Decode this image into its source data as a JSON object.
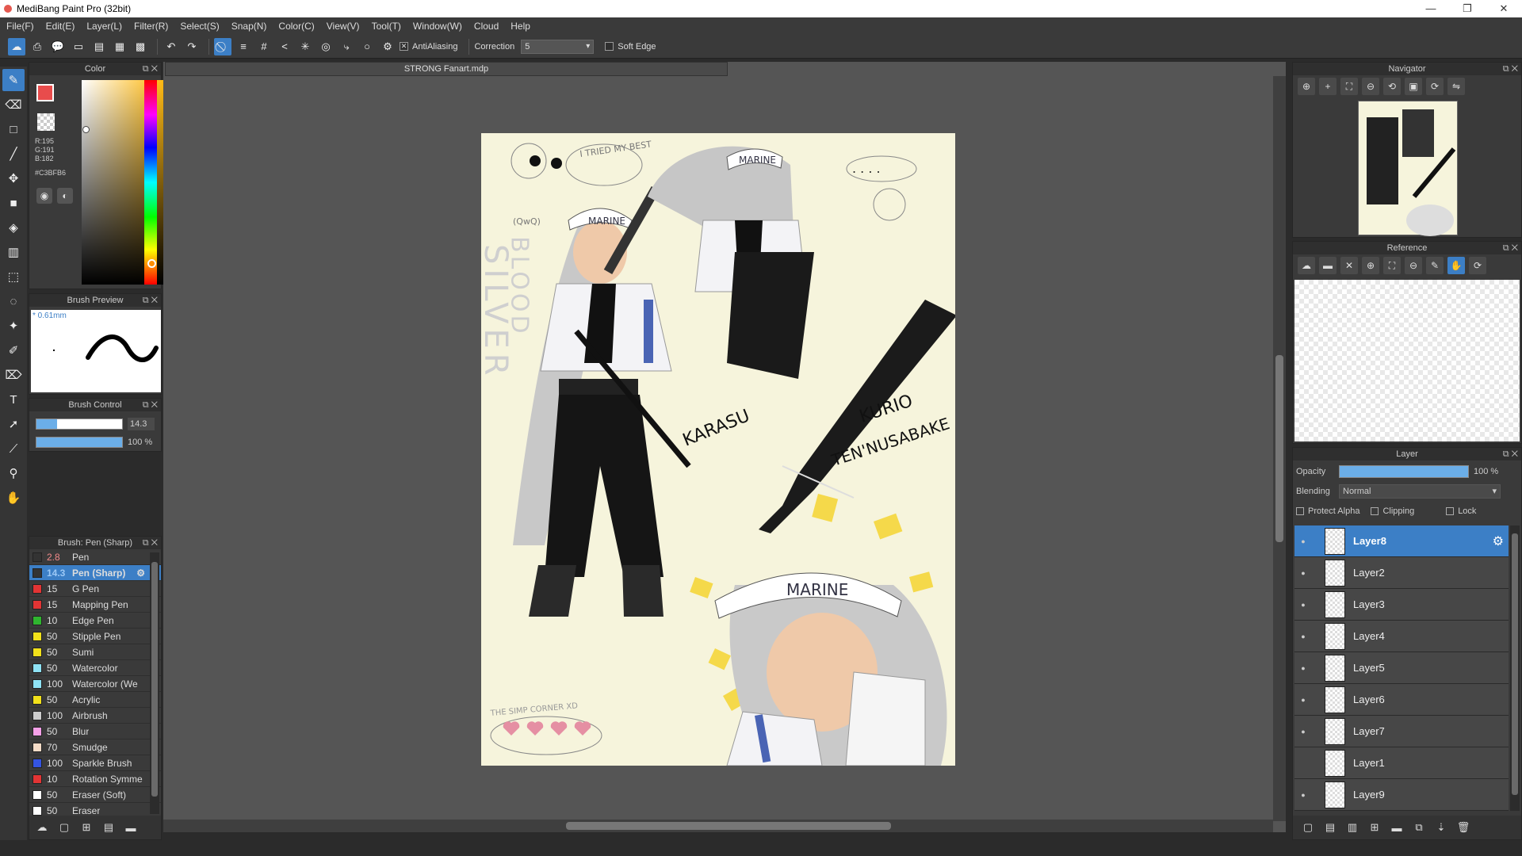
{
  "window": {
    "title": "MediBang Paint Pro (32bit)",
    "controls": [
      "—",
      "❐",
      "✕"
    ]
  },
  "menu": [
    "File(F)",
    "Edit(E)",
    "Layer(L)",
    "Filter(R)",
    "Select(S)",
    "Snap(N)",
    "Color(C)",
    "View(V)",
    "Tool(T)",
    "Window(W)",
    "Cloud",
    "Help"
  ],
  "toolbar": {
    "antialiasing_label": "AntiAliasing",
    "antialiasing_checked": true,
    "correction_label": "Correction",
    "correction_value": "5",
    "soft_edge_label": "Soft Edge"
  },
  "color_panel": {
    "title": "Color",
    "r": "R:195",
    "g": "G:191",
    "b": "B:182",
    "hex": "#C3BFB6",
    "foreground": "#e84c4c"
  },
  "brush_preview": {
    "title": "Brush Preview",
    "size_label": "* 0.61mm"
  },
  "brush_control": {
    "title": "Brush Control",
    "size_value": "14.3",
    "opacity_value": "100 %",
    "size_fraction": 0.24,
    "opacity_fraction": 1.0
  },
  "brush_list": {
    "title": "Brush: Pen (Sharp)",
    "items": [
      {
        "size": "2.8",
        "name": "Pen",
        "color": "#333333",
        "selected": false,
        "red_size": true
      },
      {
        "size": "14.3",
        "name": "Pen (Sharp)",
        "color": "#333333",
        "selected": true,
        "red_size": false
      },
      {
        "size": "15",
        "name": "G Pen",
        "color": "#e23434",
        "selected": false,
        "red_size": false
      },
      {
        "size": "15",
        "name": "Mapping Pen",
        "color": "#e23434",
        "selected": false,
        "red_size": false
      },
      {
        "size": "10",
        "name": "Edge Pen",
        "color": "#2fb52f",
        "selected": false,
        "red_size": false
      },
      {
        "size": "50",
        "name": "Stipple Pen",
        "color": "#f2e11a",
        "selected": false,
        "red_size": false
      },
      {
        "size": "50",
        "name": "Sumi",
        "color": "#f2e11a",
        "selected": false,
        "red_size": false
      },
      {
        "size": "50",
        "name": "Watercolor",
        "color": "#8fe3f5",
        "selected": false,
        "red_size": false
      },
      {
        "size": "100",
        "name": "Watercolor (We",
        "color": "#8fe3f5",
        "selected": false,
        "red_size": false
      },
      {
        "size": "50",
        "name": "Acrylic",
        "color": "#f2e11a",
        "selected": false,
        "red_size": false
      },
      {
        "size": "100",
        "name": "Airbrush",
        "color": "#cccccc",
        "selected": false,
        "red_size": false
      },
      {
        "size": "50",
        "name": "Blur",
        "color": "#f5a0e8",
        "selected": false,
        "red_size": false
      },
      {
        "size": "70",
        "name": "Smudge",
        "color": "#f5dcc8",
        "selected": false,
        "red_size": false
      },
      {
        "size": "100",
        "name": "Sparkle Brush",
        "color": "#3454e2",
        "selected": false,
        "red_size": false
      },
      {
        "size": "10",
        "name": "Rotation Symme",
        "color": "#e23434",
        "selected": false,
        "red_size": false
      },
      {
        "size": "50",
        "name": "Eraser (Soft)",
        "color": "#ffffff",
        "selected": false,
        "red_size": false
      },
      {
        "size": "50",
        "name": "Eraser",
        "color": "#ffffff",
        "selected": false,
        "red_size": false
      }
    ]
  },
  "document": {
    "tab_title": "STRONG Fanart.mdp"
  },
  "artwork_text": {
    "marine_1": "MARINE",
    "marine_2": "MARINE",
    "marine_3": "MARINE",
    "silver": "SILVER",
    "blood": "BLOOD",
    "karasu": "KARASU",
    "kurio": "KURIO",
    "tennusabake": "TEN'NUSABAKE",
    "tried": "I TRIED MY BEST",
    "dots": ". . . .",
    "qwq": "(QwQ)",
    "simp": "THE SIMP CORNER XD"
  },
  "navigator": {
    "title": "Navigator"
  },
  "reference": {
    "title": "Reference"
  },
  "layer_panel": {
    "title": "Layer",
    "opacity_label": "Opacity",
    "opacity_value": "100 %",
    "blending_label": "Blending",
    "blending_value": "Normal",
    "protect_alpha_label": "Protect Alpha",
    "clipping_label": "Clipping",
    "lock_label": "Lock",
    "layers": [
      {
        "name": "Layer8",
        "selected": true,
        "visible": true
      },
      {
        "name": "Layer2",
        "selected": false,
        "visible": true
      },
      {
        "name": "Layer3",
        "selected": false,
        "visible": true
      },
      {
        "name": "Layer4",
        "selected": false,
        "visible": true
      },
      {
        "name": "Layer5",
        "selected": false,
        "visible": true
      },
      {
        "name": "Layer6",
        "selected": false,
        "visible": true
      },
      {
        "name": "Layer7",
        "selected": false,
        "visible": true
      },
      {
        "name": "Layer1",
        "selected": false,
        "visible": false
      },
      {
        "name": "Layer9",
        "selected": false,
        "visible": true
      }
    ]
  },
  "colors": {
    "accent": "#3c7fc6",
    "panel": "#3a3a3a",
    "canvas_bg": "#555555",
    "paper": "#f6f4dc"
  }
}
